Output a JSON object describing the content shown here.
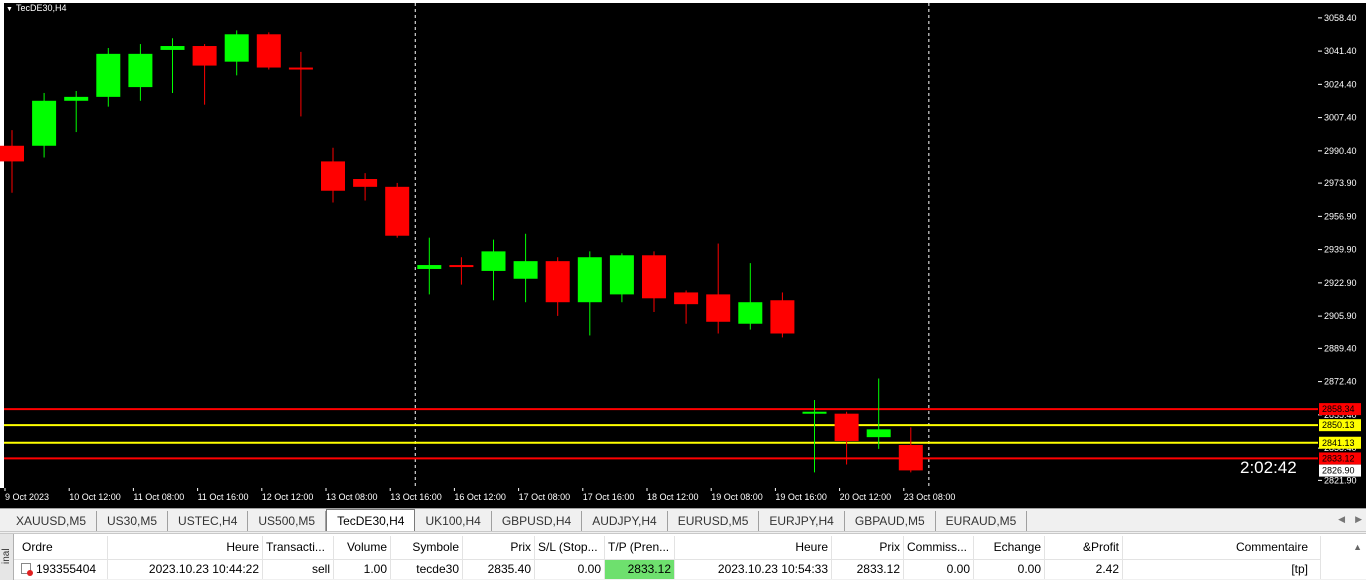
{
  "chart": {
    "title": "TecDE30,H4",
    "countdown": "2:02:42",
    "background": "#000000",
    "bull_color": "#00ff00",
    "bear_color": "#ff0000",
    "price_levels": [
      "3058.40",
      "3041.40",
      "3024.40",
      "3007.40",
      "2990.40",
      "2973.90",
      "2956.90",
      "2939.90",
      "2922.90",
      "2905.90",
      "2889.40",
      "2872.40",
      "2855.40",
      "2838.40",
      "2821.90"
    ],
    "time_labels": [
      "9 Oct 2023",
      "10 Oct 12:00",
      "11 Oct 08:00",
      "11 Oct 16:00",
      "12 Oct 12:00",
      "13 Oct 08:00",
      "13 Oct 16:00",
      "16 Oct 12:00",
      "17 Oct 08:00",
      "17 Oct 16:00",
      "18 Oct 12:00",
      "19 Oct 08:00",
      "19 Oct 16:00",
      "20 Oct 12:00",
      "23 Oct 08:00"
    ],
    "hlines": [
      {
        "price": 2858.34,
        "label": "2858.34",
        "color": "#ff0000"
      },
      {
        "price": 2850.13,
        "label": "2850.13",
        "color": "#ffff00"
      },
      {
        "price": 2841.13,
        "label": "2841.13",
        "color": "#ffff00"
      },
      {
        "price": 2833.12,
        "label": "2833.12",
        "color": "#ff0000"
      }
    ],
    "current_price": "2826.90",
    "vlines_after": [
      12,
      28
    ],
    "candles": [
      {
        "o": 2993,
        "h": 3001,
        "l": 2969,
        "c": 2985
      },
      {
        "o": 2993,
        "h": 3020,
        "l": 2987,
        "c": 3016
      },
      {
        "o": 3016,
        "h": 3021,
        "l": 3000,
        "c": 3018
      },
      {
        "o": 3018,
        "h": 3043,
        "l": 3013,
        "c": 3040
      },
      {
        "o": 3023,
        "h": 3045,
        "l": 3016,
        "c": 3040
      },
      {
        "o": 3042,
        "h": 3048,
        "l": 3020,
        "c": 3044
      },
      {
        "o": 3044,
        "h": 3045,
        "l": 3014,
        "c": 3034
      },
      {
        "o": 3036,
        "h": 3052,
        "l": 3029,
        "c": 3050
      },
      {
        "o": 3050,
        "h": 3051,
        "l": 3032,
        "c": 3033
      },
      {
        "o": 3033,
        "h": 3041,
        "l": 3008,
        "c": 3032
      },
      {
        "o": 2985,
        "h": 2992,
        "l": 2964,
        "c": 2970
      },
      {
        "o": 2976,
        "h": 2979,
        "l": 2965,
        "c": 2972
      },
      {
        "o": 2972,
        "h": 2974,
        "l": 2946,
        "c": 2947
      },
      {
        "o": 2930,
        "h": 2946,
        "l": 2917,
        "c": 2932
      },
      {
        "o": 2932,
        "h": 2936,
        "l": 2922,
        "c": 2931
      },
      {
        "o": 2929,
        "h": 2945,
        "l": 2914,
        "c": 2939
      },
      {
        "o": 2925,
        "h": 2948,
        "l": 2913,
        "c": 2934
      },
      {
        "o": 2934,
        "h": 2936,
        "l": 2906,
        "c": 2913
      },
      {
        "o": 2913,
        "h": 2939,
        "l": 2896,
        "c": 2936
      },
      {
        "o": 2917,
        "h": 2938,
        "l": 2913,
        "c": 2937
      },
      {
        "o": 2937,
        "h": 2939,
        "l": 2908,
        "c": 2915
      },
      {
        "o": 2918,
        "h": 2919,
        "l": 2902,
        "c": 2912
      },
      {
        "o": 2917,
        "h": 2943,
        "l": 2897,
        "c": 2903
      },
      {
        "o": 2902,
        "h": 2933,
        "l": 2899,
        "c": 2913
      },
      {
        "o": 2914,
        "h": 2918,
        "l": 2895,
        "c": 2897
      },
      {
        "o": 2856,
        "h": 2863,
        "l": 2826,
        "c": 2857
      },
      {
        "o": 2856,
        "h": 2857,
        "l": 2830,
        "c": 2842
      },
      {
        "o": 2844,
        "h": 2874,
        "l": 2838,
        "c": 2848
      },
      {
        "o": 2840,
        "h": 2849,
        "l": 2826,
        "c": 2827
      }
    ]
  },
  "tabs": [
    "XAUUSD,M5",
    "US30,M5",
    "USTEC,H4",
    "US500,M5",
    "TecDE30,H4",
    "UK100,H4",
    "GBPUSD,H4",
    "AUDJPY,H4",
    "EURUSD,M5",
    "EURJPY,H4",
    "GBPAUD,M5",
    "EURAUD,M5"
  ],
  "active_tab": "TecDE30,H4",
  "terminal": {
    "side_label": "inal",
    "headers": [
      "Ordre",
      "Heure",
      "Transacti...",
      "Volume",
      "Symbole",
      "Prix",
      "S/L (Stop...",
      "T/P (Pren...",
      "Heure",
      "Prix",
      "Commiss...",
      "Echange",
      "&Profit",
      "Commentaire"
    ],
    "row": {
      "ordre": "193355404",
      "heure_open": "2023.10.23 10:44:22",
      "type": "sell",
      "volume": "1.00",
      "symbole": "tecde30",
      "prix_open": "2835.40",
      "sl": "0.00",
      "tp": "2833.12",
      "heure_close": "2023.10.23 10:54:33",
      "prix_close": "2833.12",
      "commission": "0.00",
      "echange": "0.00",
      "profit": "2.42",
      "commentaire": "[tp]"
    }
  }
}
